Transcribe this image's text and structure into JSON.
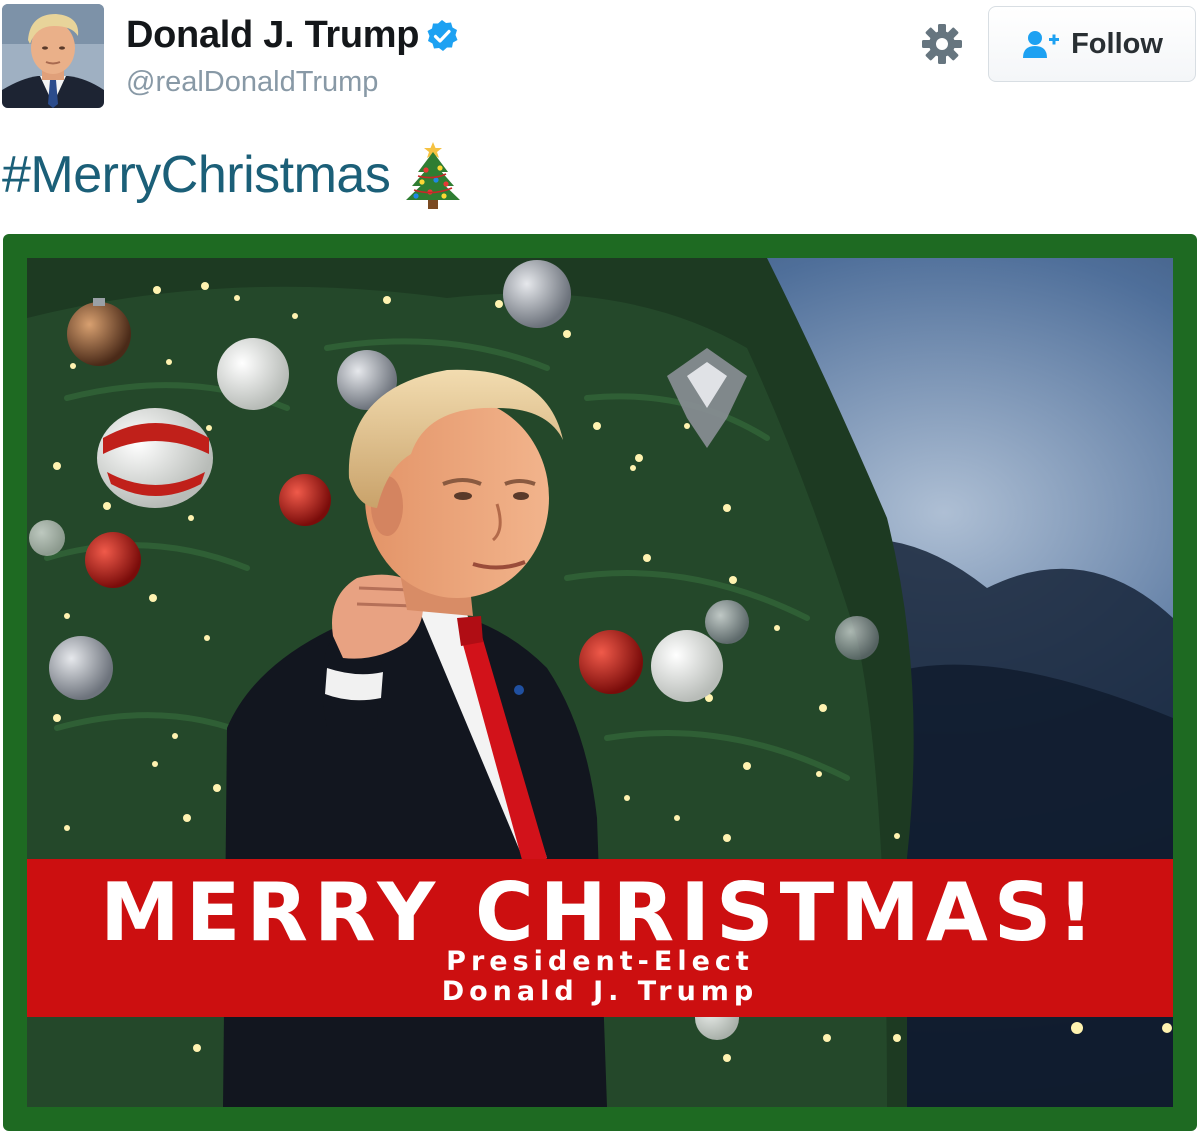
{
  "author": {
    "display_name": "Donald J. Trump",
    "handle": "@realDonaldTrump",
    "verified": true,
    "avatar_icon": "profile-photo"
  },
  "actions": {
    "settings_icon": "gear-icon",
    "follow_label": "Follow",
    "follow_icon": "add-user-icon"
  },
  "tweet": {
    "hashtag": "#MerryChristmas",
    "emoji": "christmas-tree"
  },
  "media": {
    "banner_title": "MERRY CHRISTMAS!",
    "banner_line1": "President-Elect",
    "banner_line2": "Donald J. Trump"
  },
  "colors": {
    "hashtag": "#1b5f78",
    "verified_badge": "#1da1f2",
    "follow_icon": "#1da1f2",
    "frame_green": "#1e6a22",
    "banner_red": "#cc0f10"
  }
}
